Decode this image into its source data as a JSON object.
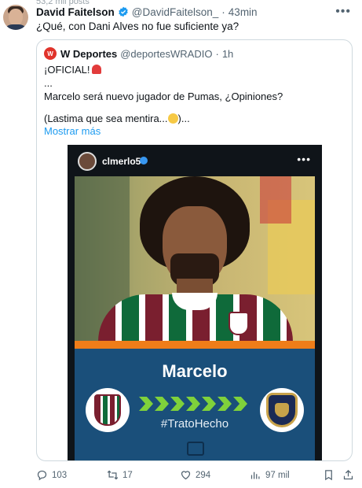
{
  "top_cut_text": "53,2 mil posts",
  "author": {
    "name": "David Faitelson",
    "handle": "@DavidFaitelson_",
    "separator": "·",
    "time": "43min"
  },
  "tweet_text": "¿Qué, con Dani Alves no fue suficiente ya?",
  "quoted": {
    "name": "W Deportes",
    "handle": "@deportesWRADIO",
    "separator": "·",
    "time": "1h",
    "logo_text": "W",
    "line1": "¡OFICIAL!",
    "line2": "...",
    "line3": "Marcelo será nuevo jugador de Pumas, ¿Opiniones?",
    "line4_a": "(Lastima que sea mentira...",
    "line4_b": ")...",
    "show_more": "Mostrar más"
  },
  "media": {
    "ig_username": "clmerlo5",
    "player_name": "Marcelo",
    "hashtag": "#TratoHecho",
    "arrow_color": "#7fd13b",
    "panel_color": "#1a4f7a",
    "strip_color": "#ef7d19"
  },
  "actions": {
    "replies": "103",
    "retweets": "17",
    "likes": "294",
    "views": "97 mil"
  },
  "colors": {
    "link": "#1d9bf0",
    "secondary_text": "#536471",
    "verified": "#1d9bf0"
  },
  "icons": [
    "verified-badge-icon",
    "more-options-icon",
    "reply-icon",
    "retweet-icon",
    "like-icon",
    "views-icon",
    "bookmark-icon",
    "share-icon"
  ]
}
